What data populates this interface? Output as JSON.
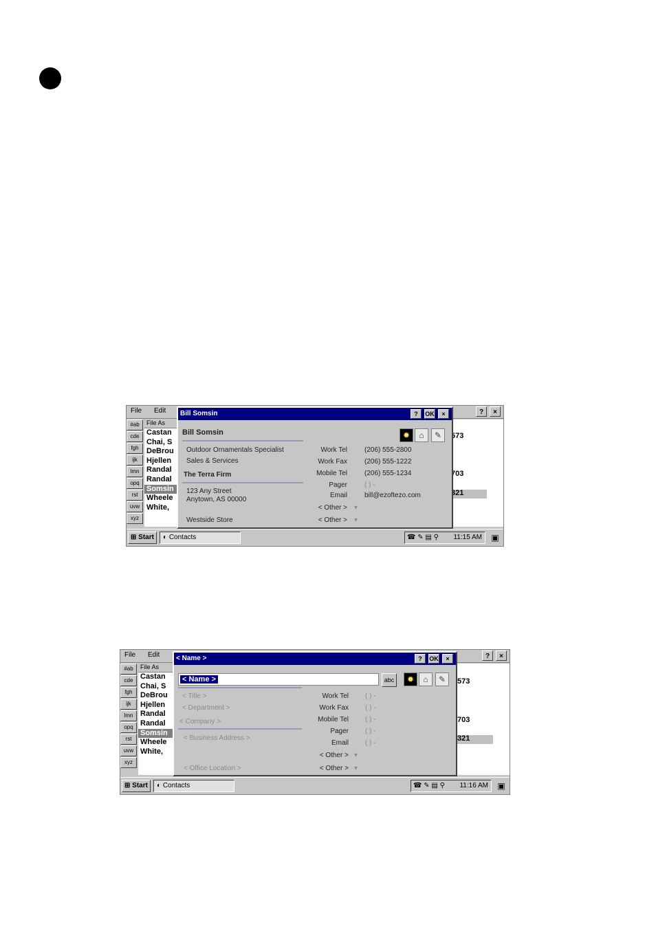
{
  "screen1": {
    "menu": [
      "File",
      "Edit"
    ],
    "window_buttons": [
      "?",
      "×"
    ],
    "tabs": [
      "#ab",
      "cde",
      "fgh",
      "ijk",
      "lmn",
      "opq",
      "rst",
      "uvw",
      "xyz"
    ],
    "list_header": "File As",
    "list_rows": [
      "Castan",
      "Chai, S",
      "DeBrou",
      "Hjellen",
      "Randal",
      "Randal",
      "Somsin",
      "Wheele",
      "White,"
    ],
    "list_selected": 6,
    "right_values": [
      "573",
      "703",
      "321"
    ],
    "dialog": {
      "title": "Bill Somsin",
      "buttons": [
        "?",
        "OK",
        "×"
      ],
      "name": "Bill Somsin",
      "job_title": "Outdoor Ornamentals Specialist",
      "department": "Sales & Services",
      "company": "The Terra Firm",
      "address_line1": "123 Any Street",
      "address_line2": "Anytown, AS 00000",
      "office": "Westside Store",
      "fields": [
        {
          "label": "Work Tel",
          "value": "(206) 555-2800"
        },
        {
          "label": "Work Fax",
          "value": "(206) 555-1222"
        },
        {
          "label": "Mobile Tel",
          "value": "(206) 555-1234"
        },
        {
          "label": "Pager",
          "value": "(   )   -"
        },
        {
          "label": "Email",
          "value": "bill@ezoftezo.com"
        },
        {
          "label": "< Other >",
          "value": ""
        },
        {
          "label": "< Other >",
          "value": ""
        }
      ]
    },
    "taskbar": {
      "start": "Start",
      "task": "Contacts",
      "time": "11:15 AM"
    }
  },
  "screen2": {
    "menu": [
      "File",
      "Edit"
    ],
    "window_buttons": [
      "?",
      "×"
    ],
    "tabs": [
      "#ab",
      "cde",
      "fgh",
      "ijk",
      "lmn",
      "opq",
      "rst",
      "uvw",
      "xyz"
    ],
    "list_header": "File As",
    "list_rows": [
      "Castan",
      "Chai, S",
      "DeBrou",
      "Hjellen",
      "Randal",
      "Randal",
      "Somsin",
      "Wheele",
      "White,"
    ],
    "list_selected": 6,
    "right_values": [
      "573",
      "703",
      "321"
    ],
    "dialog": {
      "title": "< Name >",
      "buttons": [
        "?",
        "OK",
        "×"
      ],
      "name_field": "< Name >",
      "kbd_label": "abc",
      "title_ph": "< Title >",
      "department_ph": "< Department >",
      "company_ph": "< Company >",
      "address_ph": "< Business Address >",
      "office_ph": "< Office Location >",
      "fields": [
        {
          "label": "Work Tel",
          "value": "(   )   -"
        },
        {
          "label": "Work Fax",
          "value": "(   )   -"
        },
        {
          "label": "Mobile Tel",
          "value": "(   )   -"
        },
        {
          "label": "Pager",
          "value": "(   )   -"
        },
        {
          "label": "Email",
          "value": "(   )   -"
        },
        {
          "label": "< Other >",
          "value": ""
        },
        {
          "label": "< Other >",
          "value": ""
        }
      ]
    },
    "taskbar": {
      "start": "Start",
      "task": "Contacts",
      "time": "11:16 AM"
    }
  }
}
